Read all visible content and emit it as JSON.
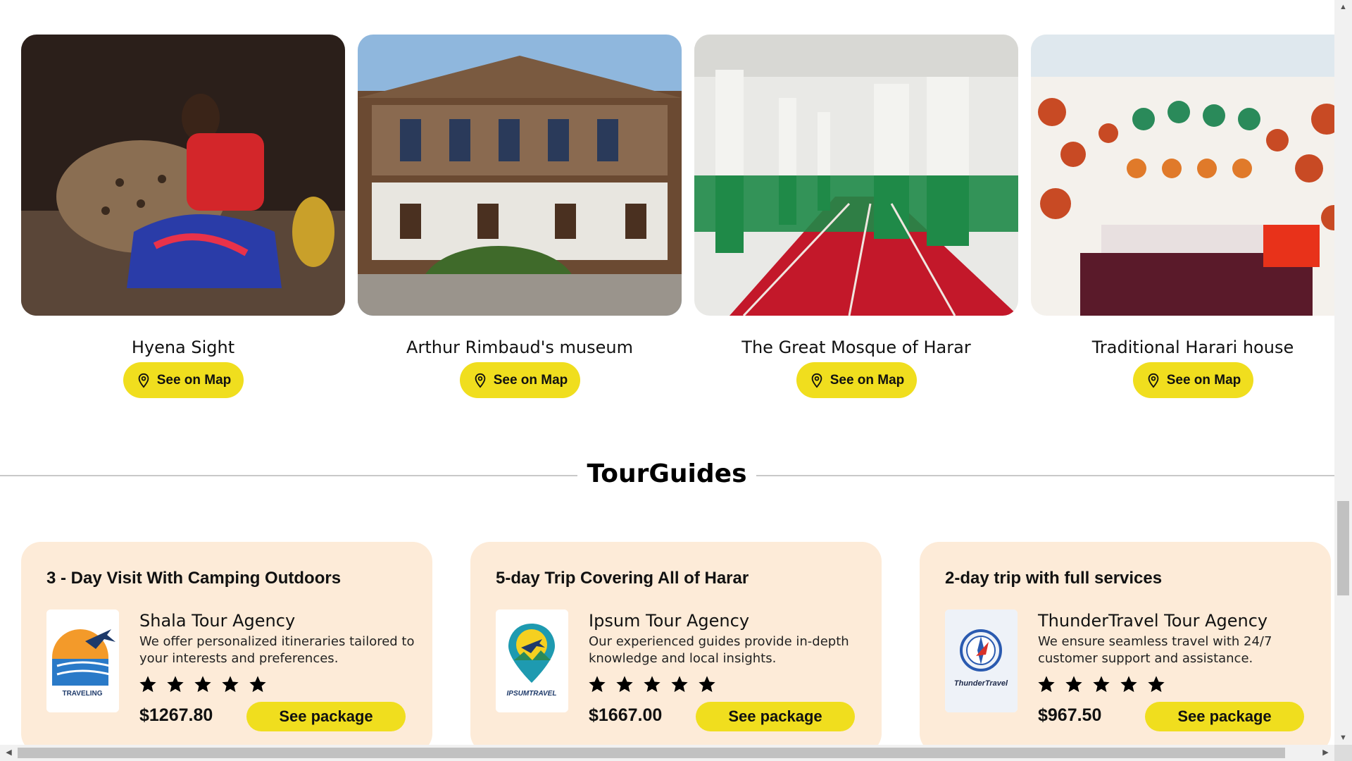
{
  "attractions": [
    {
      "name": "Hyena Sight",
      "button": "See on Map",
      "icon": "map-pin-icon"
    },
    {
      "name": "Arthur Rimbaud's museum",
      "button": "See on Map",
      "icon": "map-pin-icon"
    },
    {
      "name": "The Great Mosque of Harar",
      "button": "See on Map",
      "icon": "map-pin-icon"
    },
    {
      "name": "Traditional Harari house",
      "button": "See on Map",
      "icon": "map-pin-icon"
    }
  ],
  "section": {
    "title": "TourGuides"
  },
  "packages": [
    {
      "title": "3 - Day Visit With Camping Outdoors",
      "agency": "Shala Tour Agency",
      "description": "We offer personalized itineraries tailored to your interests and preferences.",
      "rating": 5,
      "price": "$1267.80",
      "button": "See package",
      "logo_text": "TRAVELING"
    },
    {
      "title": "5-day Trip Covering All of Harar",
      "agency": "Ipsum Tour Agency",
      "description": "Our experienced guides provide in-depth knowledge and local insights.",
      "rating": 5,
      "price": "$1667.00",
      "button": "See package",
      "logo_text": "IPSUMTRAVEL"
    },
    {
      "title": "2-day trip with full services",
      "agency": "ThunderTravel Tour Agency",
      "description": "We ensure seamless travel with 24/7 customer support and assistance.",
      "rating": 5,
      "price": "$967.50",
      "button": "See package",
      "logo_text": "ThunderTravel"
    }
  ],
  "colors": {
    "accent": "#f0de1e",
    "card_bg": "#fdebd8",
    "divider": "#c9c9c9"
  }
}
